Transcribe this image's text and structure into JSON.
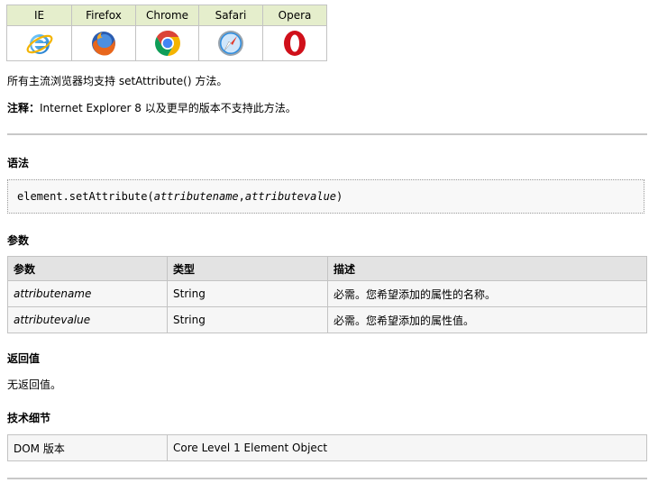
{
  "browser_support": {
    "headers": [
      "IE",
      "Firefox",
      "Chrome",
      "Safari",
      "Opera"
    ],
    "icons": [
      "ie-icon",
      "firefox-icon",
      "chrome-icon",
      "safari-icon",
      "opera-icon"
    ]
  },
  "support_text": "所有主流浏览器均支持 setAttribute() 方法。",
  "note": {
    "label": "注释：",
    "text": "Internet Explorer 8 以及更早的版本不支持此方法。"
  },
  "syntax": {
    "heading": "语法",
    "code_prefix": "element.setAttribute(",
    "param1": "attributename",
    "separator": ",",
    "param2": "attributevalue",
    "code_suffix": ")"
  },
  "params": {
    "heading": "参数",
    "columns": [
      "参数",
      "类型",
      "描述"
    ],
    "rows": [
      {
        "name": "attributename",
        "type": "String",
        "desc": "必需。您希望添加的属性的名称。"
      },
      {
        "name": "attributevalue",
        "type": "String",
        "desc": "必需。您希望添加的属性值。"
      }
    ]
  },
  "return_value": {
    "heading": "返回值",
    "text": "无返回值。"
  },
  "tech_details": {
    "heading": "技术细节",
    "label": "DOM 版本",
    "value": "Core Level 1 Element Object"
  }
}
